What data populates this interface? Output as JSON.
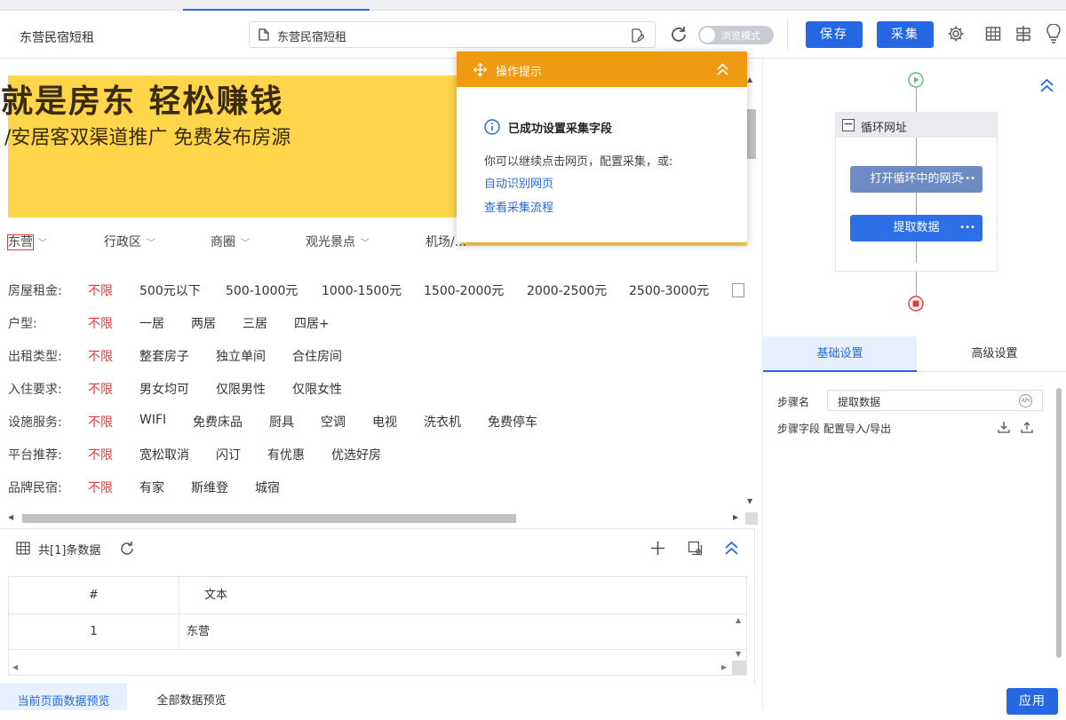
{
  "toolbar": {
    "tab_title": "东营民宿短租",
    "url_text": "东营民宿短租",
    "browse_mode_label": "浏览模式",
    "save_label": "保存",
    "collect_label": "采集"
  },
  "page": {
    "banner_title": "就是房东 轻松赚钱",
    "banner_subtitle": "/安居客双渠道推广 免费发布房源",
    "nav_items": [
      "东营",
      "行政区",
      "商圈",
      "观光景点",
      "机场/..."
    ],
    "filters": [
      {
        "label": "房屋租金:",
        "options": [
          "不限",
          "500元以下",
          "500-1000元",
          "1000-1500元",
          "1500-2000元",
          "2000-2500元",
          "2500-3000元"
        ]
      },
      {
        "label": "户型:",
        "options": [
          "不限",
          "一居",
          "两居",
          "三居",
          "四居+"
        ]
      },
      {
        "label": "出租类型:",
        "options": [
          "不限",
          "整套房子",
          "独立单间",
          "合住房间"
        ]
      },
      {
        "label": "入住要求:",
        "options": [
          "不限",
          "男女均可",
          "仅限男性",
          "仅限女性"
        ]
      },
      {
        "label": "设施服务:",
        "options": [
          "不限",
          "WIFI",
          "免费床品",
          "厨具",
          "空调",
          "电视",
          "洗衣机",
          "免费停车"
        ]
      },
      {
        "label": "平台推荐:",
        "options": [
          "不限",
          "宽松取消",
          "闪订",
          "有优惠",
          "优选好房"
        ]
      },
      {
        "label": "品牌民宿:",
        "options": [
          "不限",
          "有家",
          "斯维登",
          "城宿"
        ]
      }
    ]
  },
  "hint": {
    "title": "操作提示",
    "success": "已成功设置采集字段",
    "desc": "你可以继续点击网页，配置采集，或:",
    "link_auto": "自动识别网页",
    "link_flow": "查看采集流程"
  },
  "data_panel": {
    "count_label": "共[1]条数据",
    "columns": [
      "#",
      "文本"
    ],
    "rows": [
      {
        "index": "1",
        "text": "东营"
      }
    ]
  },
  "bottom_tabs": {
    "current": "当前页面数据预览",
    "all": "全部数据预览"
  },
  "flow": {
    "loop_title": "循环网址",
    "open_page": "打开循环中的网页",
    "extract": "提取数据",
    "more": "•••"
  },
  "settings": {
    "tab_basic": "基础设置",
    "tab_advanced": "高级设置",
    "step_name_label": "步骤名",
    "step_name_value": "提取数据",
    "step_fields_label": "步骤字段",
    "import_export_label": "配置导入/导出",
    "apply_label": "应用"
  },
  "colors": {
    "accent": "#2668e4",
    "hint_header": "#ef9b12",
    "selected": "#e4393c",
    "banner": "#ffd54a"
  }
}
